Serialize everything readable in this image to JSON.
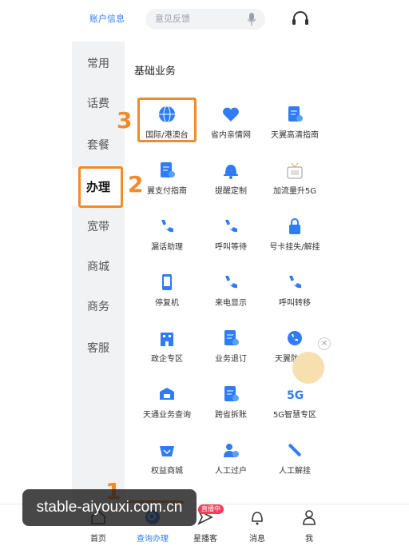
{
  "header": {
    "account_label": "账户信息",
    "search_placeholder": "意见反馈",
    "icons": {
      "mic": "mic-icon",
      "service": "headset-icon"
    }
  },
  "sidebar": {
    "items": [
      {
        "label": "常用"
      },
      {
        "label": "话费"
      },
      {
        "label": "套餐"
      },
      {
        "label": "办理"
      },
      {
        "label": "宽带"
      },
      {
        "label": "商城"
      },
      {
        "label": "商务"
      },
      {
        "label": "客服"
      }
    ],
    "active": "办理"
  },
  "section": {
    "title": "基础业务",
    "tiles": [
      {
        "label": "国际/港澳台",
        "icon": "globe-icon"
      },
      {
        "label": "省内亲情网",
        "icon": "heart-icon"
      },
      {
        "label": "天翼高清指南",
        "icon": "document-icon"
      },
      {
        "label": "翼支付指南",
        "icon": "document-icon"
      },
      {
        "label": "提醒定制",
        "icon": "bell-icon"
      },
      {
        "label": "加流量升5G",
        "icon": "gift-icon"
      },
      {
        "label": "漏话助理",
        "icon": "phone-icon"
      },
      {
        "label": "呼叫等待",
        "icon": "phone-icon"
      },
      {
        "label": "号卡挂失/解挂",
        "icon": "lock-icon"
      },
      {
        "label": "停复机",
        "icon": "mobile-icon"
      },
      {
        "label": "来电显示",
        "icon": "phone-icon"
      },
      {
        "label": "呼叫转移",
        "icon": "phone-icon"
      },
      {
        "label": "政企专区",
        "icon": "building-icon"
      },
      {
        "label": "业务退订",
        "icon": "document-icon"
      },
      {
        "label": "天翼防骚扰",
        "icon": "phone-shield-icon"
      },
      {
        "label": "天通业务查询",
        "icon": "box-icon"
      },
      {
        "label": "跨省拆账",
        "icon": "document-icon"
      },
      {
        "label": "5G智慧专区",
        "icon": "5g-icon"
      },
      {
        "label": "权益商城",
        "icon": "shop-icon"
      },
      {
        "label": "人工过户",
        "icon": "person-icon"
      },
      {
        "label": "人工解挂",
        "icon": "wrench-icon"
      }
    ]
  },
  "annotations": {
    "step1": "1",
    "step2": "2",
    "step3": "3",
    "color": "#f08a2a"
  },
  "tabbar": {
    "items": [
      {
        "label": "首页",
        "icon": "home-icon"
      },
      {
        "label": "查询办理",
        "icon": "search-icon"
      },
      {
        "label": "星播客",
        "icon": "send-icon"
      },
      {
        "label": "消息",
        "icon": "bell-icon"
      },
      {
        "label": "我",
        "icon": "person-icon"
      }
    ],
    "active": "查询办理",
    "live_badge": "直播中"
  },
  "watermark": "stable-aiyouxi.com.cn",
  "colors": {
    "accent": "#2f7cf6",
    "annotation": "#f08a2a"
  }
}
